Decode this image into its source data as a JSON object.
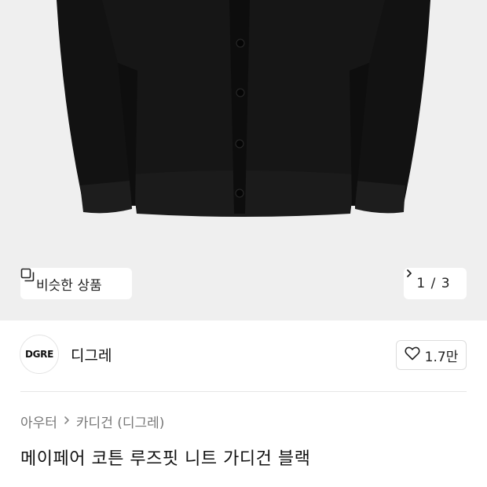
{
  "gallery": {
    "similar_label": "비슷한 상품",
    "pager_text": "1 / 3"
  },
  "brand": {
    "logo_text": "DGRE",
    "name": "디그레",
    "like_count": "1.7만"
  },
  "breadcrumb": {
    "category": "아우터",
    "subcategory": "카디건 (디그레)"
  },
  "product": {
    "title": "메이페어 코튼 루즈핏 니트 가디건 블랙"
  }
}
